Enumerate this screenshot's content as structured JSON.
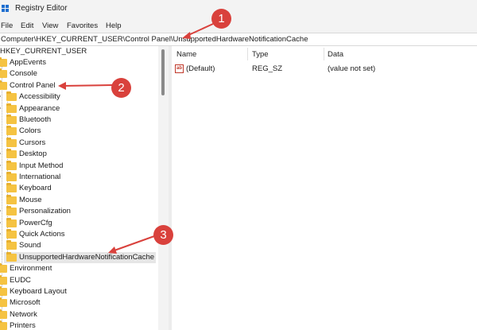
{
  "window": {
    "title": "Registry Editor"
  },
  "menu": [
    "File",
    "Edit",
    "View",
    "Favorites",
    "Help"
  ],
  "address": "Computer\\HKEY_CURRENT_USER\\Control Panel\\UnsupportedHardwareNotificationCache",
  "tree": {
    "root": "HKEY_CURRENT_USER",
    "items": [
      "AppEvents",
      "Console",
      "Control Panel",
      "Accessibility",
      "Appearance",
      "Bluetooth",
      "Colors",
      "Cursors",
      "Desktop",
      "Input Method",
      "International",
      "Keyboard",
      "Mouse",
      "Personalization",
      "PowerCfg",
      "Quick Actions",
      "Sound",
      "UnsupportedHardwareNotificationCache",
      "Environment",
      "EUDC",
      "Keyboard Layout",
      "Microsoft",
      "Network",
      "Printers"
    ],
    "selected": "UnsupportedHardwareNotificationCache"
  },
  "columns": [
    "Name",
    "Type",
    "Data"
  ],
  "values": [
    {
      "name": "(Default)",
      "type": "REG_SZ",
      "data": "(value not set)",
      "icon": "ab"
    }
  ],
  "annotations": [
    "1",
    "2",
    "3"
  ],
  "colors": {
    "annotation": "#d9413c",
    "folder": "#f5c342",
    "selection": "#e6e6e6"
  }
}
